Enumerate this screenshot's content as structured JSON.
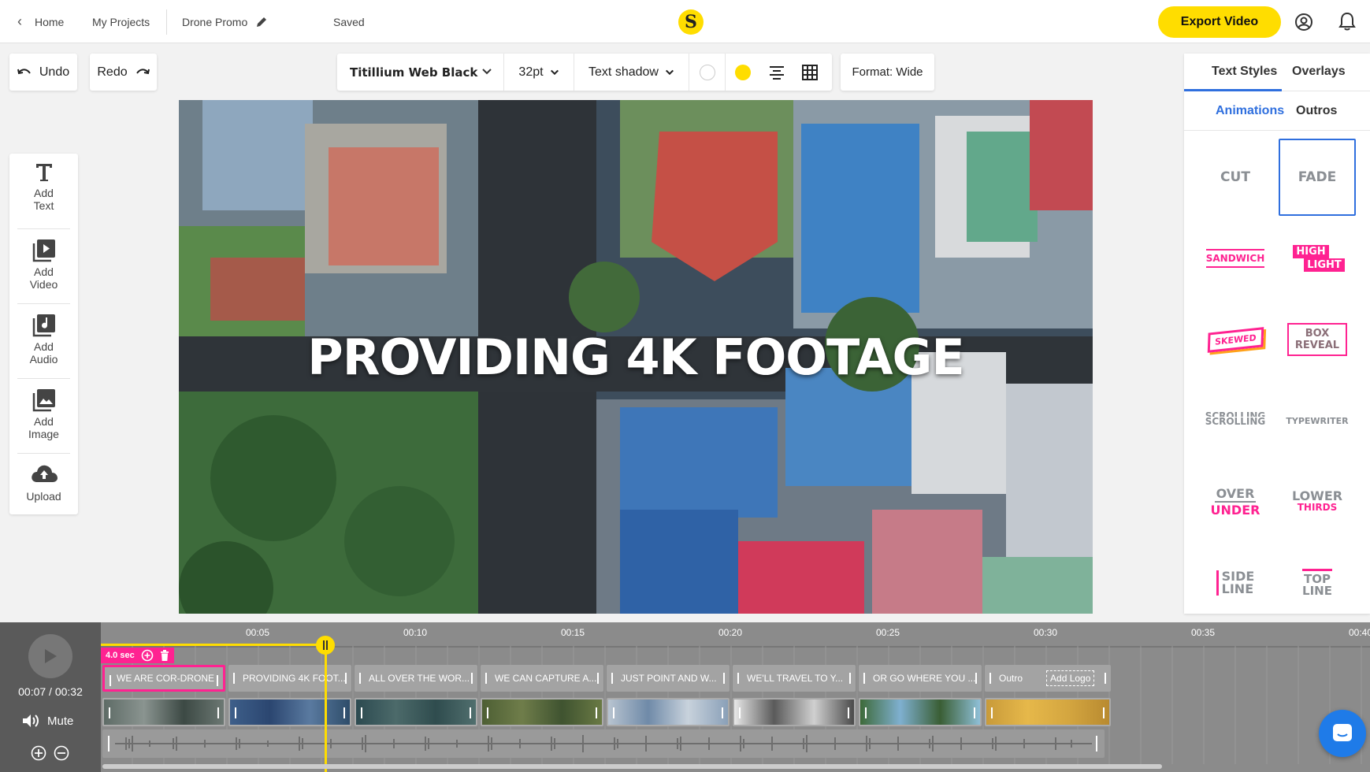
{
  "nav": {
    "home": "Home",
    "projects": "My Projects",
    "project_name": "Drone Promo",
    "status": "Saved",
    "export": "Export Video"
  },
  "toolbar": {
    "undo": "Undo",
    "redo": "Redo",
    "font": "Titillium Web Black",
    "size": "32pt",
    "effect": "Text shadow",
    "format": "Format: Wide",
    "colors": {
      "primary": "#ffffff",
      "accent": "#ffdd00"
    }
  },
  "canvas": {
    "text": "PROVIDING 4K FOOTAGE"
  },
  "sidebar": {
    "items": [
      {
        "label_line1": "Add",
        "label_line2": "Text",
        "icon": "text-icon"
      },
      {
        "label_line1": "Add",
        "label_line2": "Video",
        "icon": "video-icon"
      },
      {
        "label_line1": "Add",
        "label_line2": "Audio",
        "icon": "music-icon"
      },
      {
        "label_line1": "Add",
        "label_line2": "Image",
        "icon": "image-icon"
      },
      {
        "label_line1": "Upload",
        "label_line2": "",
        "icon": "upload-icon"
      }
    ]
  },
  "panel": {
    "tabs": [
      "Text Styles",
      "Overlays"
    ],
    "subtabs": [
      "Animations",
      "Outros"
    ],
    "animations": {
      "cut": "CUT",
      "fade": "FADE",
      "sandwich": "SANDWICH",
      "highlight_1": "HIGH",
      "highlight_2": "LIGHT",
      "skewed": "SKEWED",
      "boxreveal_1": "BOX",
      "boxreveal_2": "REVEAL",
      "scrolling_1": "SCROLLING",
      "scrolling_2": "SCROLLING",
      "typewriter": "TYPEWRITER",
      "overunder_1": "OVER",
      "overunder_2": "UNDER",
      "lowerthirds_1": "LOWER",
      "lowerthirds_2": "THIRDS",
      "sideline_1": "SIDE",
      "sideline_2": "LINE",
      "topline_1": "TOP",
      "topline_2": "LINE"
    }
  },
  "timeline": {
    "current_time": "00:07 / 00:32",
    "mute": "Mute",
    "selected_duration": "4.0 sec",
    "ruler": [
      "00:05",
      "00:10",
      "00:15",
      "00:20",
      "00:25",
      "00:30",
      "00:35",
      "00:40"
    ],
    "text_clips": [
      "WE ARE COR-DRONE",
      "PROVIDING 4K FOOT...",
      "ALL OVER THE WOR...",
      "WE CAN CAPTURE A...",
      "JUST POINT AND W...",
      "WE'LL TRAVEL TO Y...",
      "OR GO WHERE YOU ...",
      "Outro"
    ],
    "add_logo": "Add Logo",
    "brand_pink": "#ff2291"
  }
}
